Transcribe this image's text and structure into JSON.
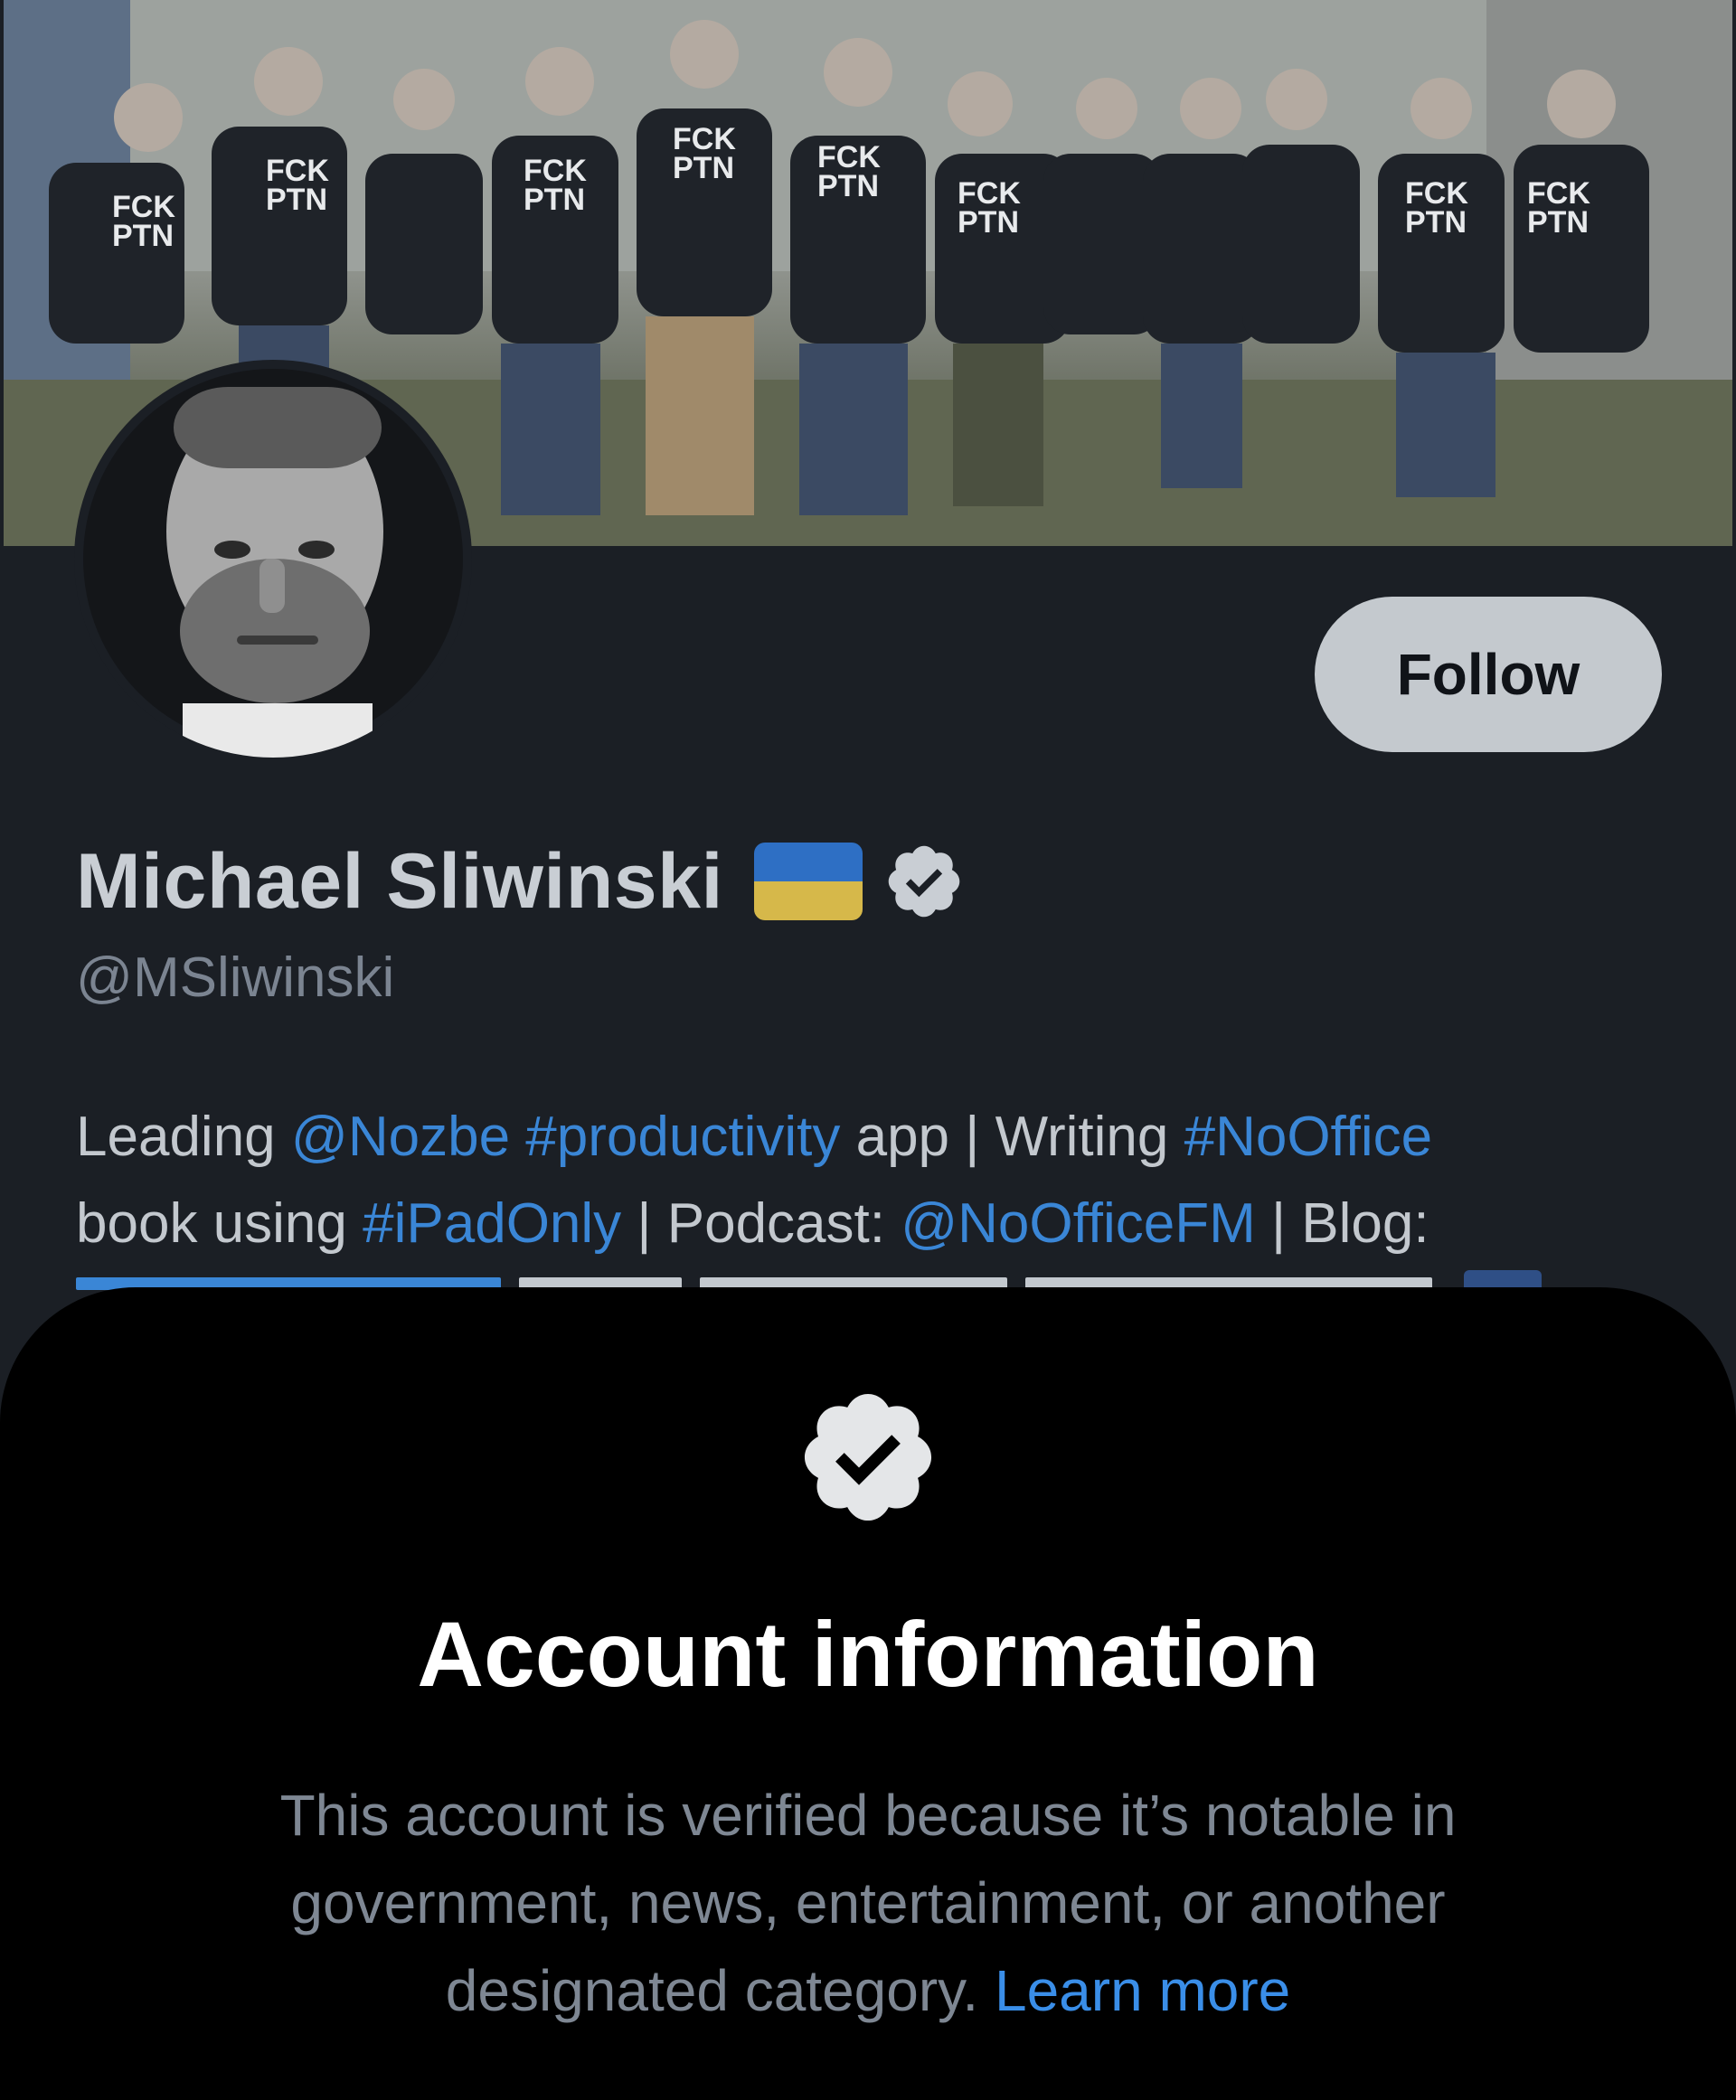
{
  "banner": {
    "shirt_text_line1": "FCK",
    "shirt_text_line2": "PTN"
  },
  "profile": {
    "display_name": "Michael Sliwinski",
    "handle": "@MSliwinski",
    "follow_label": "Follow",
    "bio": {
      "line1": {
        "t1": "Leading ",
        "mention_nozbe": "@Nozbe",
        "t2": " ",
        "tag_productivity": "#productivity",
        "t3": " app | Writing ",
        "tag_nooffice": "#NoOffice"
      },
      "line2": {
        "t1": "book using ",
        "tag_ipadonly": "#iPadOnly",
        "t2": " | Podcast: ",
        "mention_noofficefm": "@NoOfficeFM",
        "t3": " | Blog:"
      }
    }
  },
  "sheet": {
    "title": "Account information",
    "description": "This account is verified because it’s notable in government, news, entertainment, or another designated category.",
    "learn_more": "Learn more"
  },
  "icons": {
    "verified": "verified-badge-icon",
    "flag": "ukraine-flag-icon"
  },
  "colors": {
    "background": "#1b1f25",
    "sheet_background": "#000000",
    "link": "#3a86d6",
    "follow_button": "#c4c9ce",
    "flag_blue": "#2e6fc4",
    "flag_yellow": "#d6b84a"
  }
}
